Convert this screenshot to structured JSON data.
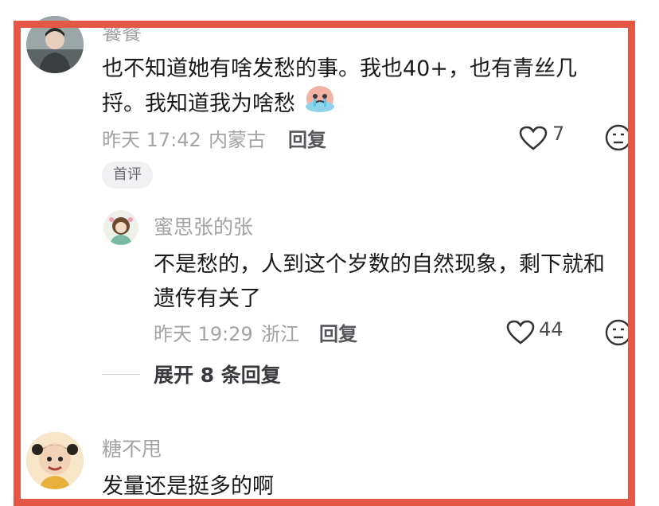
{
  "comments": [
    {
      "author": "饕餮",
      "text_line1": "也不知道她有啥发愁的事。我也40+，也有青丝几",
      "text_line2": "捋。我知道我为啥愁",
      "emoji": "crying-face-emoji",
      "time": "昨天 17:42",
      "location": "内蒙古",
      "reply_label": "回复",
      "likes": "7",
      "badge": "首评",
      "reply": {
        "author": "蜜思张的张",
        "text_line1": "不是愁的，人到这个岁数的自然现象，剩下就和",
        "text_line2": "遗传有关了",
        "time": "昨天 19:29",
        "location": "浙江",
        "reply_label": "回复",
        "likes": "44"
      },
      "expand_label": "展开 8 条回复"
    },
    {
      "author": "糖不甩",
      "text": "发量还是挺多的啊"
    }
  ],
  "colors": {
    "frame": "#e45745",
    "meta": "#a3a3a7",
    "text": "#1a1a1a"
  }
}
